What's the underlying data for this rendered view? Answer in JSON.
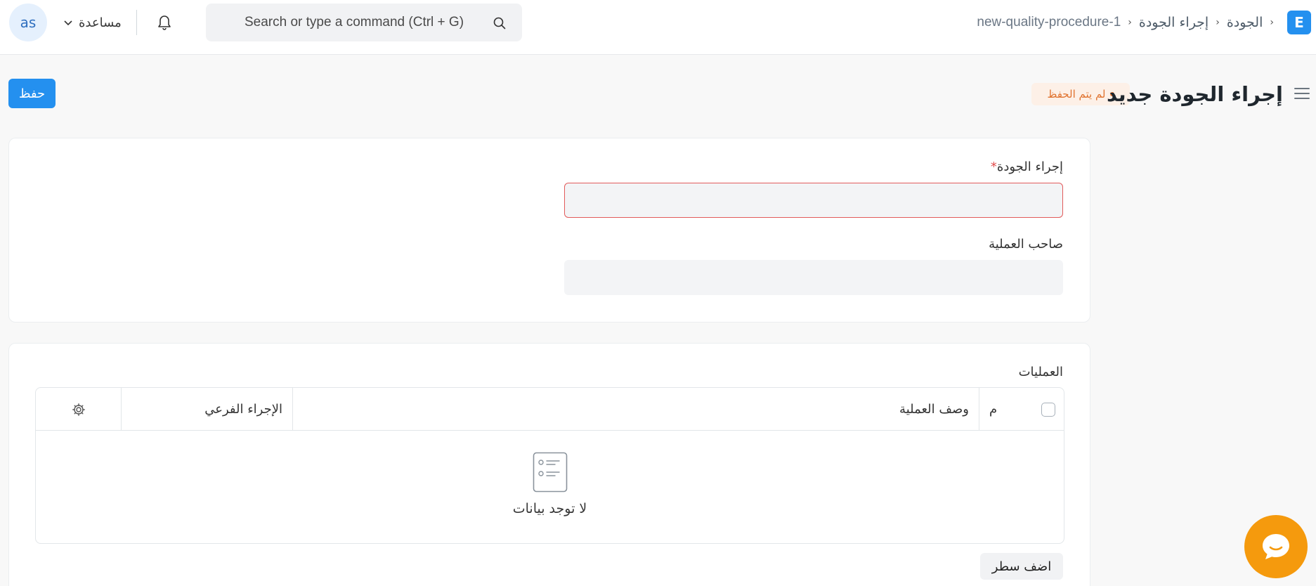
{
  "navbar": {
    "avatar_initials": "as",
    "help_label": "مساعدة",
    "search_placeholder": "Search or type a command (Ctrl + G)",
    "app_logo_letter": "E",
    "breadcrumbs": [
      "الجودة",
      "إجراء الجودة",
      "new-quality-procedure-1"
    ]
  },
  "page": {
    "title": "إجراء الجودة جديد",
    "status": "لم يتم الحفظ",
    "save_label": "حفظ"
  },
  "form": {
    "procedure_label": "إجراء الجودة",
    "procedure_required_mark": "*",
    "procedure_value": "",
    "owner_label": "صاحب العملية",
    "owner_value": ""
  },
  "processes": {
    "section_label": "العمليات",
    "columns": {
      "index": "م",
      "description": "وصف العملية",
      "sub_procedure": "الإجراء الفرعي"
    },
    "empty_text": "لا توجد بيانات",
    "add_row_label": "اضف سطر"
  },
  "colors": {
    "primary": "#2490ef",
    "warning": "#e0722e",
    "chat": "#f59a0d"
  }
}
